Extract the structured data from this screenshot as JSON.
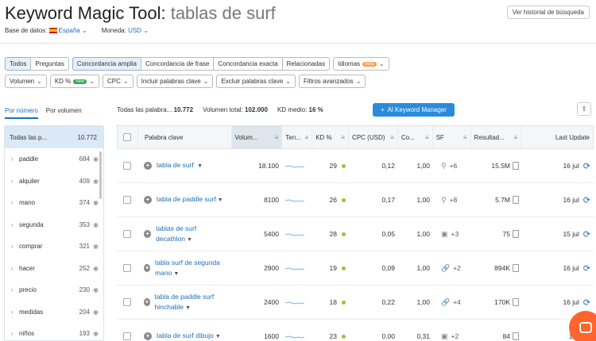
{
  "title": {
    "tool": "Keyword Magic Tool:",
    "query": "tablas de surf"
  },
  "history_button": "Ver historial de búsqueda",
  "meta": {
    "db_label": "Base de datos:",
    "db_value": "España",
    "currency_label": "Moneda:",
    "currency_value": "USD"
  },
  "filters_row1": {
    "group1": [
      "Todos",
      "Preguntas"
    ],
    "group2": [
      "Concordancia amplia",
      "Concordancia de frase",
      "Concordancia exacta",
      "Relacionadas"
    ],
    "languages": "Idiomas",
    "beta": "beta"
  },
  "filters_row2": [
    "Volumen",
    "KD %",
    "CPC",
    "Incluir palabras clave",
    "Excluir palabras clave",
    "Filtros avanzados"
  ],
  "new_badge": "new",
  "tabs": {
    "by_number": "Por número",
    "by_volume": "Por volumen"
  },
  "stats": {
    "all_label": "Todas las palabra...",
    "all_value": "10.772",
    "volume_label": "Volumen total:",
    "volume_value": "102.000",
    "kd_label": "KD medio:",
    "kd_value": "16 %"
  },
  "km_button": "Al Keyword Manager",
  "sidebar": {
    "head_label": "Todas las p...",
    "head_count": "10.772",
    "items": [
      {
        "label": "paddle",
        "count": "684"
      },
      {
        "label": "alquiler",
        "count": "409"
      },
      {
        "label": "mano",
        "count": "374"
      },
      {
        "label": "segunda",
        "count": "353"
      },
      {
        "label": "comprar",
        "count": "321"
      },
      {
        "label": "hacer",
        "count": "252"
      },
      {
        "label": "precio",
        "count": "230"
      },
      {
        "label": "medidas",
        "count": "204"
      },
      {
        "label": "niños",
        "count": "193"
      }
    ]
  },
  "table": {
    "headers": [
      "Palabra clave",
      "Volum...",
      "Ten...",
      "KD %",
      "CPC (USD)",
      "Co...",
      "SF",
      "Resultad...",
      "Last Update"
    ],
    "rows": [
      {
        "kw1": "tabla de surf",
        "kw2": "",
        "vol": "18.100",
        "kd": "29",
        "cpc": "0,12",
        "com": "1,00",
        "sf_icon": "location-icon",
        "sf": "+6",
        "res": "15.5M",
        "upd": "16 jul"
      },
      {
        "kw1": "tabla de paddle",
        "kw2": "surf",
        "vol": "8100",
        "kd": "26",
        "cpc": "0,17",
        "com": "1,00",
        "sf_icon": "location-icon",
        "sf": "+8",
        "res": "5.7M",
        "upd": "16 jul"
      },
      {
        "kw1": "tablas de surf",
        "kw2": "decathlon",
        "vol": "5400",
        "kd": "28",
        "cpc": "0,05",
        "com": "1,00",
        "sf_icon": "image-icon",
        "sf": "+3",
        "res": "75",
        "upd": "15 jul"
      },
      {
        "kw1": "tabla surf de",
        "kw2": "segunda mano",
        "vol": "2900",
        "kd": "19",
        "cpc": "0,09",
        "com": "1,00",
        "sf_icon": "link-icon",
        "sf": "+2",
        "res": "894K",
        "upd": "16 jul"
      },
      {
        "kw1": "tabla de paddle surf",
        "kw2": "hinchable",
        "vol": "2400",
        "kd": "18",
        "cpc": "0,22",
        "com": "1,00",
        "sf_icon": "link-icon",
        "sf": "+4",
        "res": "170K",
        "upd": "16 jul"
      },
      {
        "kw1": "tabla de surf",
        "kw2": "dibujo",
        "vol": "1600",
        "kd": "23",
        "cpc": "0,00",
        "com": "0,31",
        "sf_icon": "image-icon",
        "sf": "+2",
        "res": "84",
        "upd": "11 j"
      }
    ]
  },
  "colors": {
    "accent": "#1a6fbf",
    "kd_easy": "#8fc641",
    "brand": "#ff642d"
  }
}
